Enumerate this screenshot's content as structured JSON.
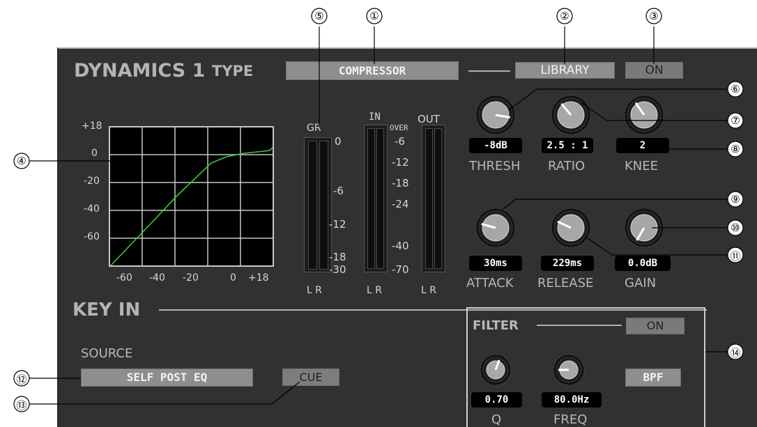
{
  "header": {
    "title": "DYNAMICS 1",
    "type_label": "TYPE",
    "type_value": "COMPRESSOR",
    "library_label": "LIBRARY",
    "on_label": "ON"
  },
  "graph": {
    "y_ticks": [
      "+18",
      "0",
      "-20",
      "-40",
      "-60"
    ],
    "x_ticks": [
      "-60",
      "-40",
      "-20",
      "0",
      "+18"
    ]
  },
  "meters": {
    "gr_label": "GR",
    "in_label": "IN",
    "over_label": "OVER",
    "out_label": "OUT",
    "gr_scale": [
      "0",
      "-6",
      "-12",
      "-18",
      "-30"
    ],
    "io_scale": [
      "-6",
      "-12",
      "-18",
      "-24",
      "-40",
      "-70"
    ],
    "lr_labels": [
      "L R",
      "L R",
      "L R"
    ]
  },
  "knobs": [
    {
      "value": "-8dB",
      "label": "THRESH",
      "angle": 100
    },
    {
      "value": "2.5 : 1",
      "label": "RATIO",
      "angle": -40
    },
    {
      "value": "2",
      "label": "KNEE",
      "angle": -35
    },
    {
      "value": "30ms",
      "label": "ATTACK",
      "angle": -75
    },
    {
      "value": "229ms",
      "label": "RELEASE",
      "angle": -65
    },
    {
      "value": "0.0dB",
      "label": "GAIN",
      "angle": -150
    }
  ],
  "key_in": {
    "title": "KEY IN",
    "source_label": "SOURCE",
    "source_value": "SELF POST EQ",
    "cue_label": "CUE"
  },
  "filter": {
    "title": "FILTER",
    "on_label": "ON",
    "q_value": "0.70",
    "q_label": "Q",
    "freq_value": "80.0Hz",
    "freq_label": "FREQ",
    "type_label": "BPF",
    "q_angle": 20,
    "freq_angle": -90
  },
  "callouts": [
    "①",
    "②",
    "③",
    "④",
    "⑤",
    "⑥",
    "⑦",
    "⑧",
    "⑨",
    "⑩",
    "⑪",
    "⑫",
    "⑬",
    "⑭"
  ],
  "colors": {
    "panel_bg": "#313131",
    "button_grey": "#8e8e8e",
    "curve_green": "#3ec83e",
    "grid_white": "#c8c8c8"
  }
}
